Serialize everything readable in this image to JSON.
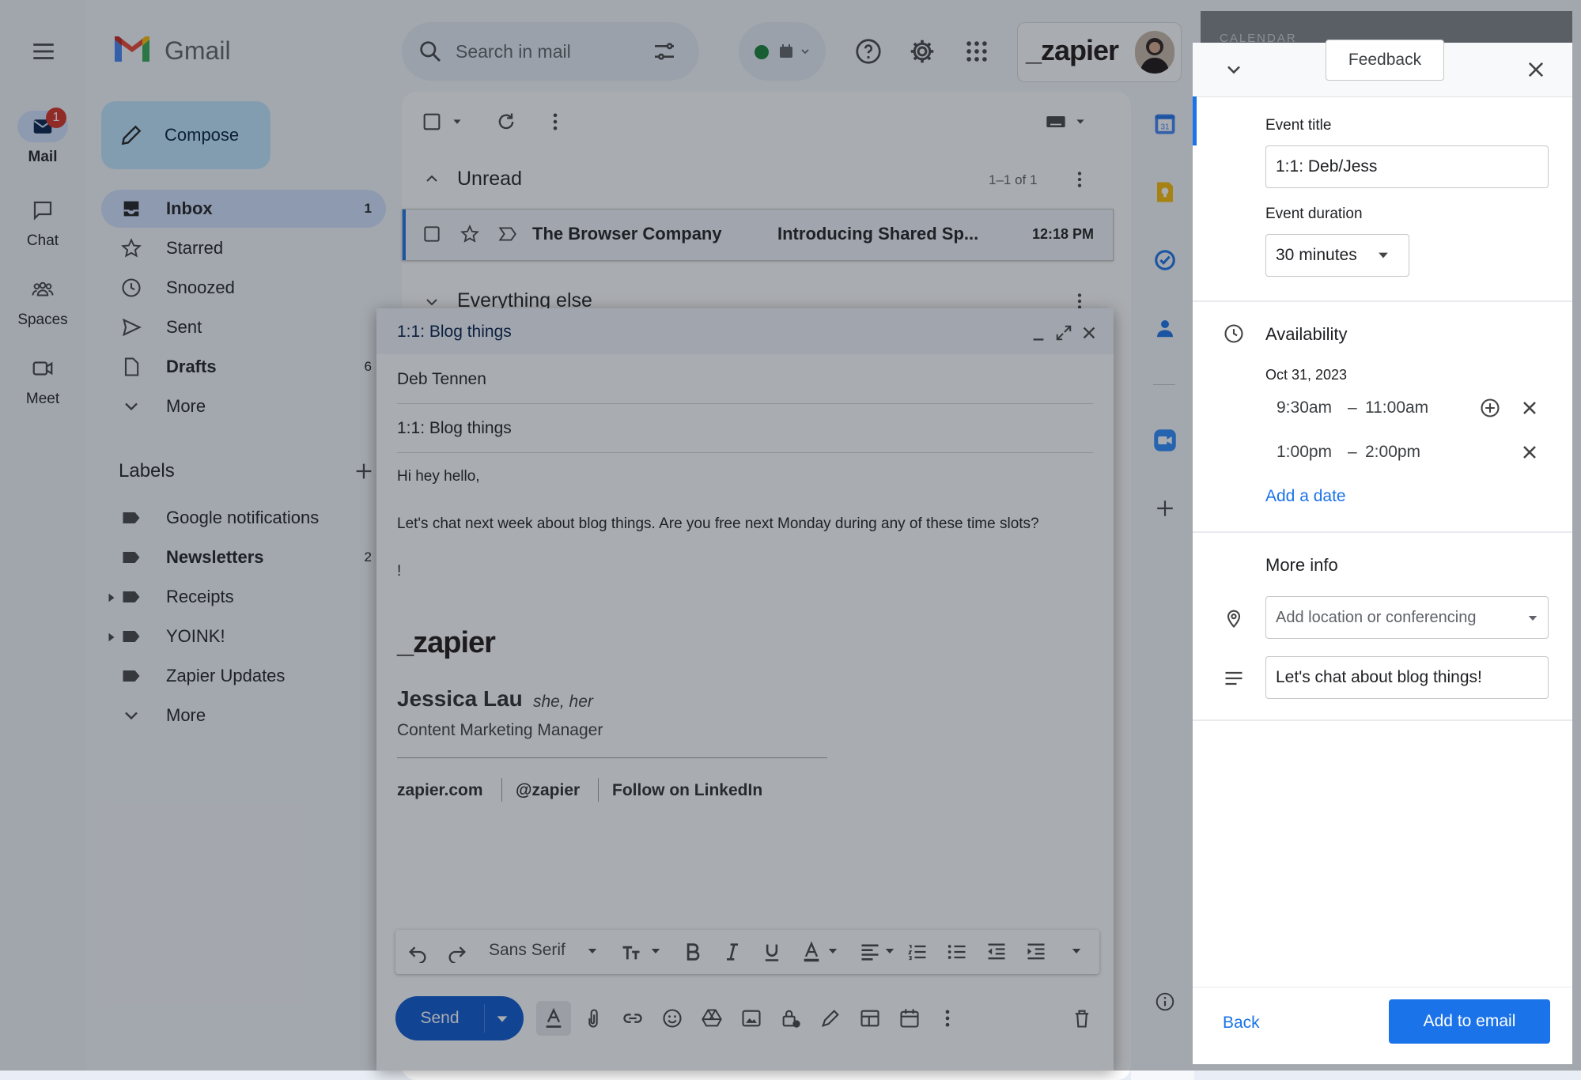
{
  "gmail": {
    "app_name": "Gmail",
    "search_placeholder": "Search in mail",
    "brand_logo_text": "_zapier",
    "rail": {
      "mail_label": "Mail",
      "mail_badge": "1",
      "chat_label": "Chat",
      "spaces_label": "Spaces",
      "meet_label": "Meet"
    },
    "compose_label": "Compose",
    "nav": [
      {
        "label": "Inbox",
        "count": "1"
      },
      {
        "label": "Starred",
        "count": ""
      },
      {
        "label": "Snoozed",
        "count": ""
      },
      {
        "label": "Sent",
        "count": ""
      },
      {
        "label": "Drafts",
        "count": "6"
      },
      {
        "label": "More",
        "count": ""
      }
    ],
    "labels_title": "Labels",
    "labels": [
      {
        "label": "Google notifications",
        "count": ""
      },
      {
        "label": "Newsletters",
        "count": "2"
      },
      {
        "label": "Receipts",
        "count": ""
      },
      {
        "label": "YOINK!",
        "count": ""
      },
      {
        "label": "Zapier Updates",
        "count": ""
      },
      {
        "label": "More",
        "count": ""
      }
    ],
    "list": {
      "section_unread": "Unread",
      "unread_range": "1–1 of 1",
      "section_else": "Everything else",
      "email": {
        "sender": "The Browser Company",
        "subject": "Introducing Shared Sp...",
        "time": "12:18 PM"
      }
    }
  },
  "compose": {
    "title": "1:1: Blog things",
    "to": "Deb Tennen",
    "subject": "1:1: Blog things",
    "body_line1": "Hi hey hello,",
    "body_line2": "Let's chat next week about blog things. Are you free next Monday during any of these time slots?",
    "body_line3": "!",
    "signature": {
      "logo": "_zapier",
      "name": "Jessica Lau",
      "pronouns": "she, her",
      "role": "Content Marketing Manager",
      "link1": "zapier.com",
      "link2": "@zapier",
      "link3": "Follow on LinkedIn"
    },
    "font_name": "Sans Serif",
    "send_label": "Send"
  },
  "scheduler": {
    "background_header": "CALENDAR",
    "feedback_label": "Feedback",
    "event_title_label": "Event title",
    "event_title_value": "1:1: Deb/Jess",
    "event_duration_label": "Event duration",
    "event_duration_value": "30 minutes",
    "availability_title": "Availability",
    "date": "Oct 31, 2023",
    "slots": [
      {
        "start": "9:30am",
        "sep": "–",
        "end": "11:00am"
      },
      {
        "start": "1:00pm",
        "sep": "–",
        "end": "2:00pm"
      }
    ],
    "add_date_label": "Add a date",
    "more_info_title": "More info",
    "location_placeholder": "Add location or conferencing",
    "description_value": "Let's chat about blog things!",
    "back_label": "Back",
    "add_to_email_label": "Add to email"
  },
  "colors": {
    "accent_blue": "#1a73e8",
    "send_blue": "#0b57d0",
    "badge_red": "#d93025",
    "zapier_orange": "#ff4f00"
  }
}
